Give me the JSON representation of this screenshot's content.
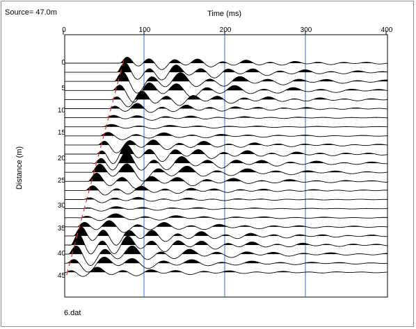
{
  "header": {
    "source_label": "Source= 47.0m"
  },
  "chart_data": {
    "type": "seismogram",
    "xlabel": "Time (ms)",
    "ylabel": "Distance (m)",
    "xlim": [
      0,
      400
    ],
    "x_ticks": [
      "0",
      "100",
      "200",
      "300",
      "400"
    ],
    "y_ticks": [
      "0",
      "5",
      "10",
      "15",
      "20",
      "25",
      "30",
      "35",
      "40",
      "45"
    ],
    "trace_distances_m": [
      0,
      2,
      4,
      6,
      8,
      10,
      12,
      14,
      16,
      18,
      20,
      22,
      24,
      26,
      28,
      30,
      32,
      34,
      36,
      38,
      40,
      42,
      44,
      46
    ],
    "gridlines_ms": [
      100,
      200,
      300
    ],
    "source_position_m": 47.0,
    "first_break_picks_ms": [
      70,
      67,
      64,
      61,
      58,
      55,
      52,
      49,
      46,
      43,
      40,
      37,
      34,
      31,
      28,
      25,
      22,
      19,
      16,
      13,
      10,
      7,
      4,
      1
    ],
    "gridline_color": "#2f6fd0",
    "pick_color": "#e0302a",
    "trace_color": "#000000"
  },
  "footer": {
    "file_name": "6.dat"
  }
}
